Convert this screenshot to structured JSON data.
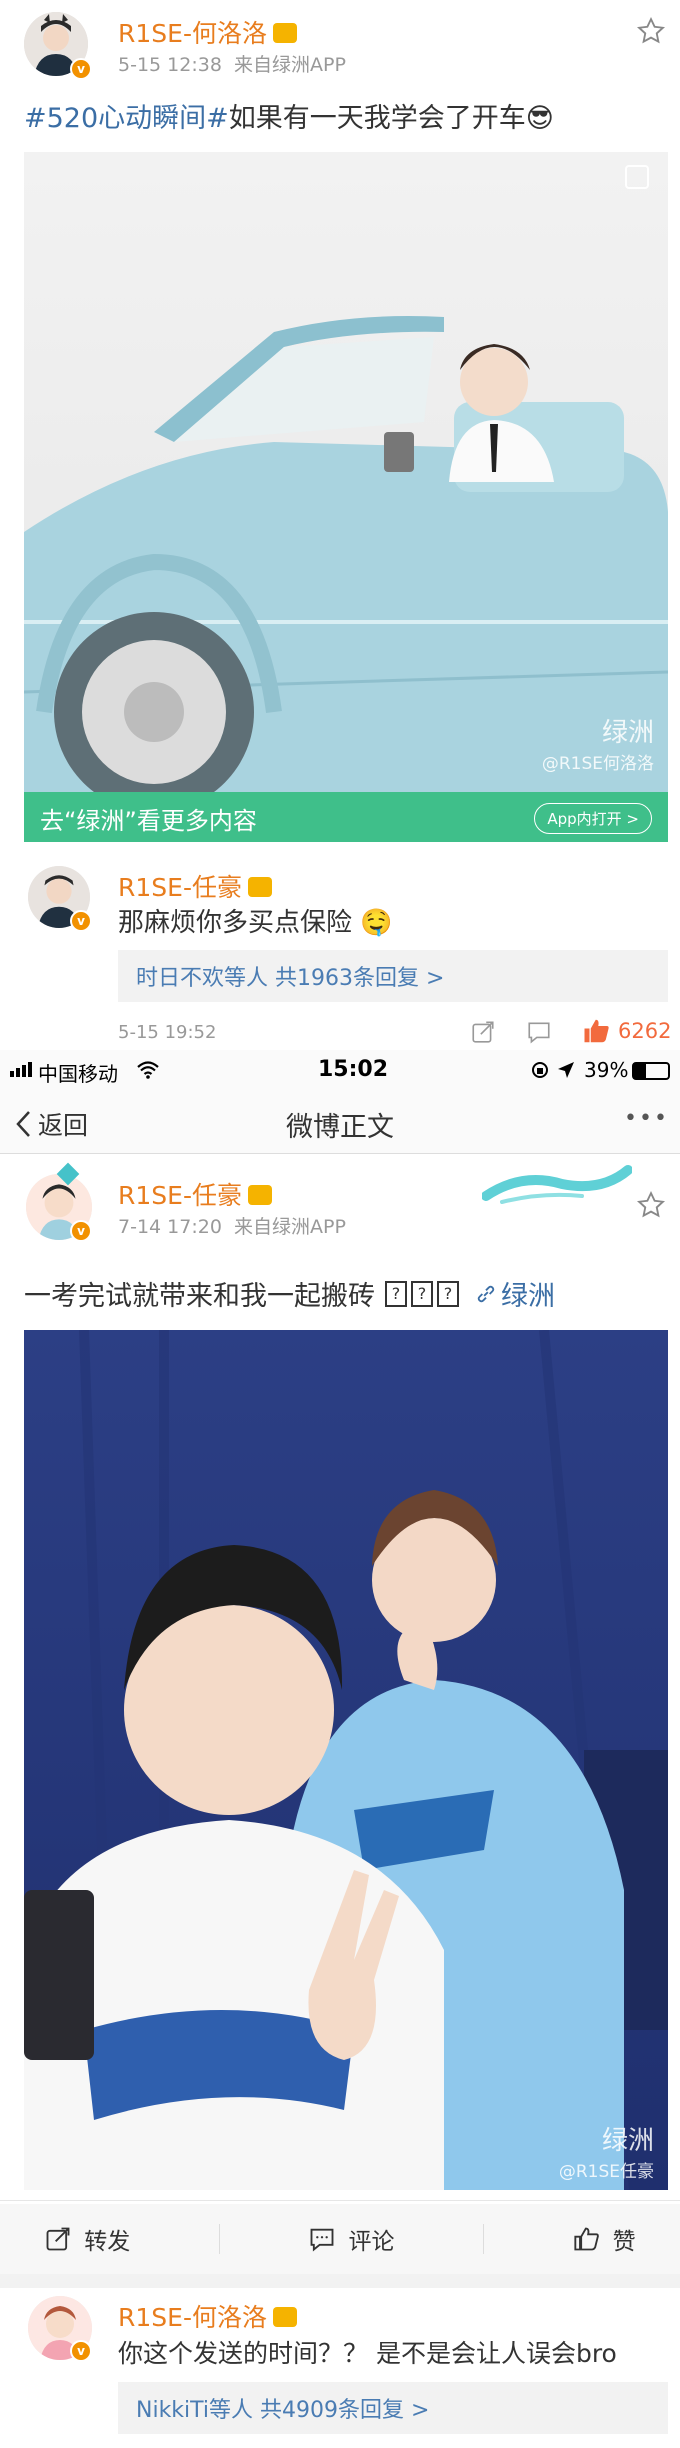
{
  "post1": {
    "username": "R1SE-何洛洛",
    "time": "5-15 12:38",
    "source": "来自绿洲APP",
    "topic": "#520心动瞬间#",
    "text": "如果有一天我学会了开车",
    "emoji": "😎",
    "watermark_line1": "绿洲",
    "watermark_line2": "@R1SE何洛洛",
    "oasis_banner": "去“绿洲”看更多内容",
    "open_app": "App内打开 >"
  },
  "comment1": {
    "username": "R1SE-任豪",
    "text": "那麻烦你多买点保险",
    "emoji": "🤤",
    "replies": "时日不欢等人  共1963条回复 >",
    "time": "5-15 19:52",
    "likes": "6262"
  },
  "statusbar": {
    "carrier": "中国移动",
    "time": "15:02",
    "battery": "39%"
  },
  "navbar": {
    "back": "返回",
    "title": "微博正文",
    "more": "•••"
  },
  "post2": {
    "username": "R1SE-任豪",
    "time": "7-14 17:20",
    "source": "来自绿洲APP",
    "text": "一考完试就带来和我一起搬砖",
    "unknown_glyphs": [
      "?",
      "?",
      "?"
    ],
    "link": "绿洲",
    "watermark_line1": "绿洲",
    "watermark_line2": "@R1SE任豪"
  },
  "actions": {
    "repost": "转发",
    "comment": "评论",
    "like": "赞"
  },
  "comment2": {
    "username": "R1SE-何洛洛",
    "text": "你这个发送的时间？？ 是不是会让人误会bro",
    "replies": "NikkiTi等人  共4909条回复 >"
  },
  "colors": {
    "accent_orange": "#e87d1e",
    "link_blue": "#3b6ea5",
    "oasis_green": "#3fbf8a"
  }
}
